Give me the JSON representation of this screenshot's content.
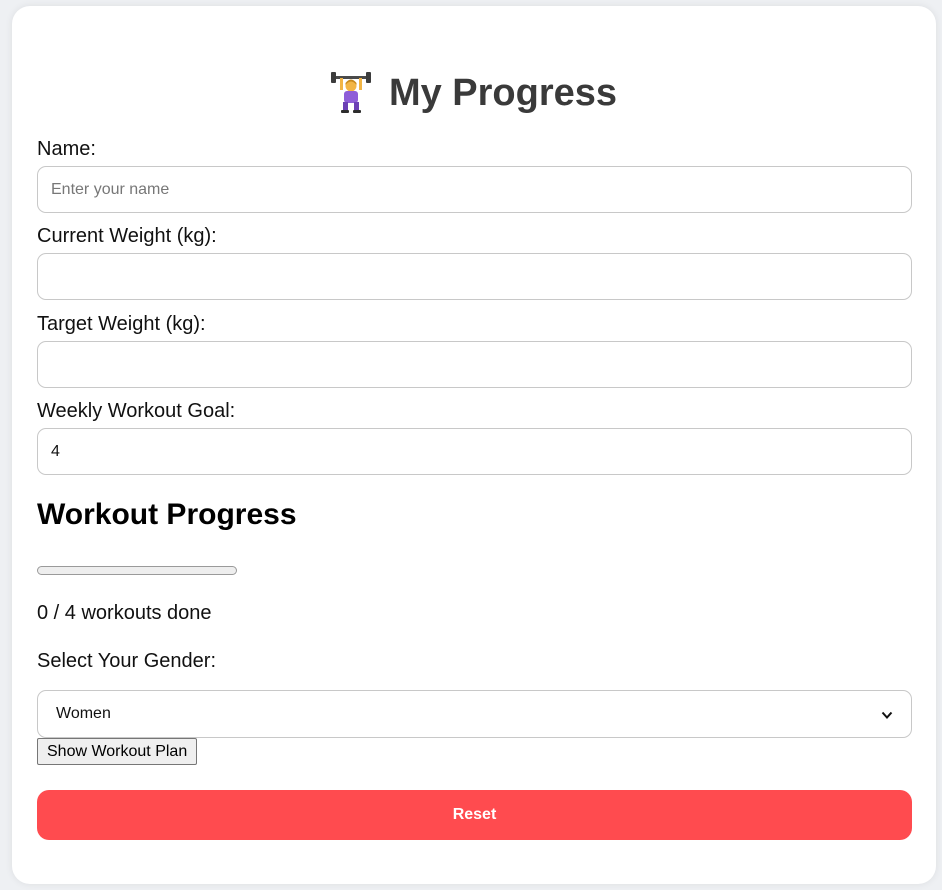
{
  "header": {
    "icon": "weightlifting-woman-icon",
    "title": "My Progress"
  },
  "form": {
    "name": {
      "label": "Name:",
      "placeholder": "Enter your name",
      "value": ""
    },
    "current_weight": {
      "label": "Current Weight (kg):",
      "value": ""
    },
    "target_weight": {
      "label": "Target Weight (kg):",
      "value": ""
    },
    "weekly_goal": {
      "label": "Weekly Workout Goal:",
      "value": "4"
    }
  },
  "progress": {
    "heading": "Workout Progress",
    "completed": 0,
    "goal": 4,
    "fraction": 0,
    "text": "0 / 4 workouts done"
  },
  "gender": {
    "label": "Select Your Gender:",
    "selected": "Women"
  },
  "buttons": {
    "show_plan": "Show Workout Plan",
    "reset": "Reset"
  },
  "colors": {
    "reset_bg": "#ff4b4f",
    "title": "#3a3a3a",
    "card_bg": "#ffffff",
    "page_bg": "#eef0f3"
  }
}
